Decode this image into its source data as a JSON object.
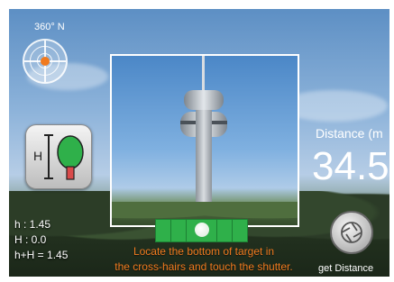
{
  "compass": {
    "heading_label": "360° N"
  },
  "height_button": {
    "label": "H"
  },
  "stats": {
    "h": "h : 1.45",
    "H": "H : 0.0",
    "sum": "h+H = 1.45"
  },
  "distance": {
    "label": "Distance (m",
    "value": "34.5"
  },
  "instructions": {
    "line1": "Locate the bottom of target in",
    "line2": "the cross-hairs and touch the shutter."
  },
  "shutter": {
    "label": "get Distance"
  },
  "colors": {
    "accent": "#f07a1f",
    "level": "#2fb04a"
  }
}
